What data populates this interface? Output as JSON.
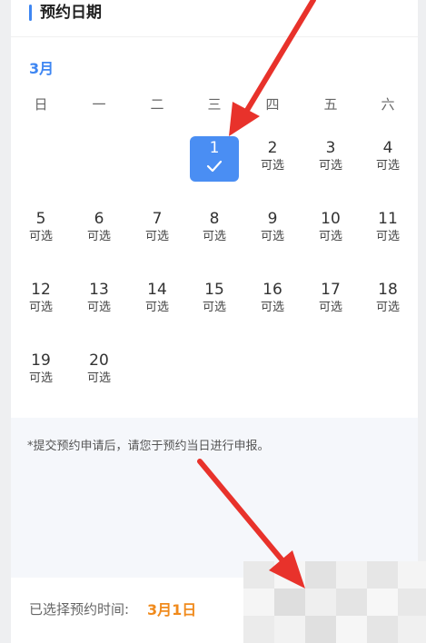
{
  "header": {
    "title": "预约日期"
  },
  "calendar": {
    "month_label": "3月",
    "weekdays": [
      "日",
      "一",
      "二",
      "三",
      "四",
      "五",
      "六"
    ],
    "available_label": "可选",
    "days": {
      "d1": "1",
      "d2": "2",
      "d3": "3",
      "d4": "4",
      "d5": "5",
      "d6": "6",
      "d7": "7",
      "d8": "8",
      "d9": "9",
      "d10": "10",
      "d11": "11",
      "d12": "12",
      "d13": "13",
      "d14": "14",
      "d15": "15",
      "d16": "16",
      "d17": "17",
      "d18": "18",
      "d19": "19",
      "d20": "20"
    },
    "selected_day": "1"
  },
  "notice": {
    "text": "*提交预约申请后，请您于预约当日进行申报。"
  },
  "footer": {
    "label": "已选择预约时间:",
    "value": "3月1日"
  },
  "colors": {
    "accent": "#3e86f2",
    "selected_bg": "#4a8ef3",
    "highlight": "#f08a1c",
    "arrow": "#e8322b"
  }
}
